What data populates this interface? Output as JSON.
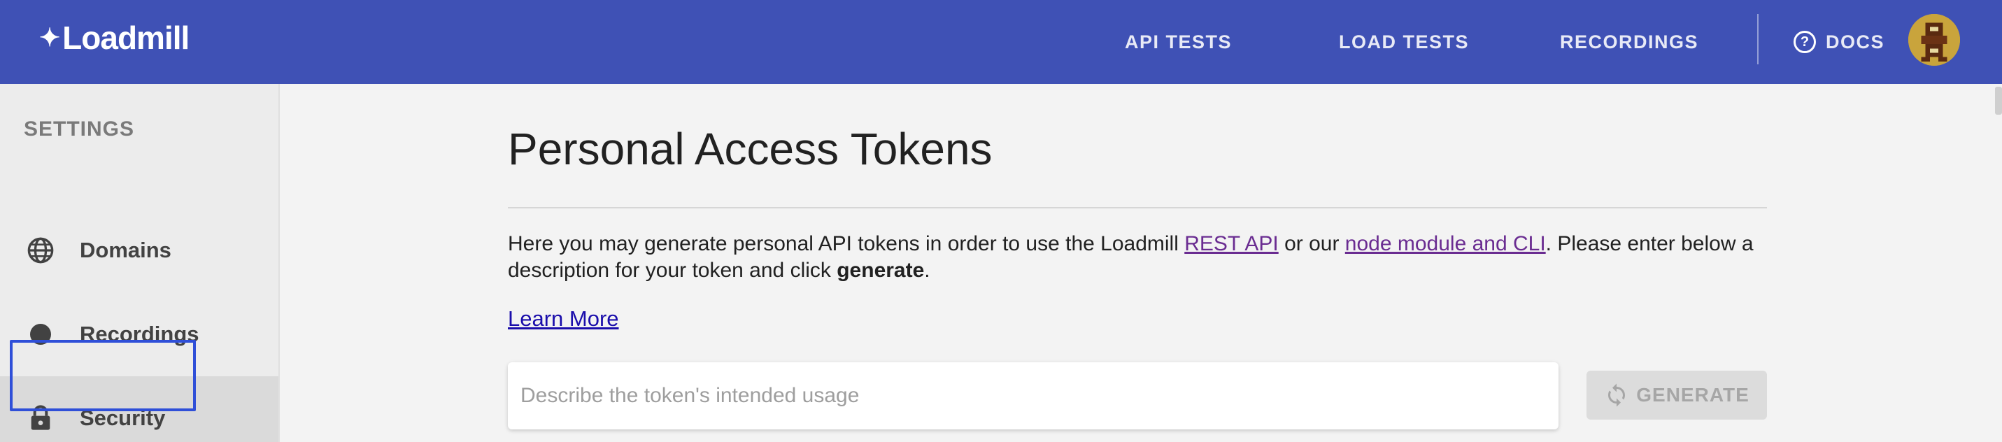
{
  "app": {
    "logo_text": "Loadmill",
    "brand_color": "#3f51b5"
  },
  "header": {
    "nav": [
      {
        "label": "API TESTS"
      },
      {
        "label": "LOAD TESTS"
      },
      {
        "label": "RECORDINGS"
      }
    ],
    "docs_label": "DOCS",
    "docs_icon": "help-circle-icon",
    "avatar_icon": "user-avatar"
  },
  "sidebar": {
    "title": "SETTINGS",
    "items": [
      {
        "label": "Domains",
        "icon": "globe-icon"
      },
      {
        "label": "Recordings",
        "icon": "record-dot-icon"
      },
      {
        "label": "Security",
        "icon": "lock-icon",
        "selected": true
      }
    ]
  },
  "main": {
    "title": "Personal Access Tokens",
    "description": {
      "part1": "Here you may generate personal API tokens in order to use the Loadmill ",
      "link1": "REST API",
      "part2": " or our ",
      "link2": "node module and CLI",
      "part3": ". Please enter below a description for your token and click ",
      "bold": "generate",
      "part4": "."
    },
    "learn_more": "Learn More",
    "token_input": {
      "placeholder": "Describe the token's intended usage",
      "value": ""
    },
    "generate_button": {
      "label": "GENERATE",
      "icon": "refresh-icon",
      "disabled": true
    }
  }
}
